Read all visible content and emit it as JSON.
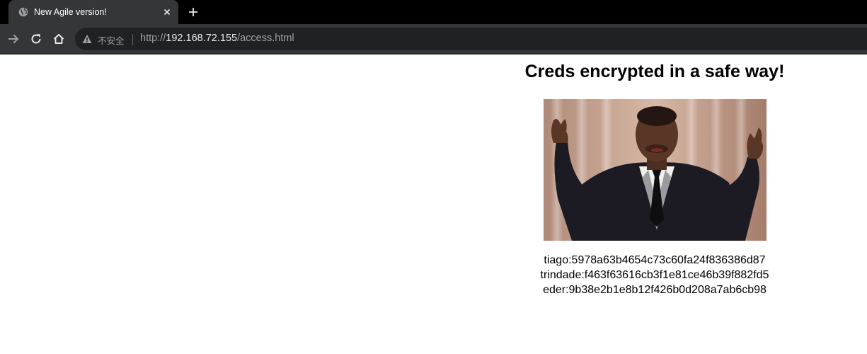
{
  "browser": {
    "tab": {
      "title": "New Agile version!",
      "favicon": "globe-icon"
    },
    "address_bar": {
      "security_label": "不安全",
      "url_scheme": "http://",
      "url_host": "192.168.72.155",
      "url_path": "/access.html"
    },
    "icons": {
      "back": "arrow-right-icon",
      "reload": "reload-icon",
      "home": "home-icon",
      "warning": "warning-triangle-icon",
      "close": "close-icon",
      "new_tab": "plus-icon"
    },
    "colors": {
      "tabstrip_bg": "#000000",
      "toolbar_bg": "#35363a",
      "omnibox_bg": "#202124"
    }
  },
  "page": {
    "heading": "Creds encrypted in a safe way!",
    "image": "photo of a man in a tuxedo with raised hands",
    "credentials": [
      "tiago:5978a63b4654c73c60fa24f836386d87",
      "trindade:f463f63616cb3f1e81ce46b39f882fd5",
      "eder:9b38e2b1e8b12f426b0d208a7ab6cb98"
    ]
  }
}
